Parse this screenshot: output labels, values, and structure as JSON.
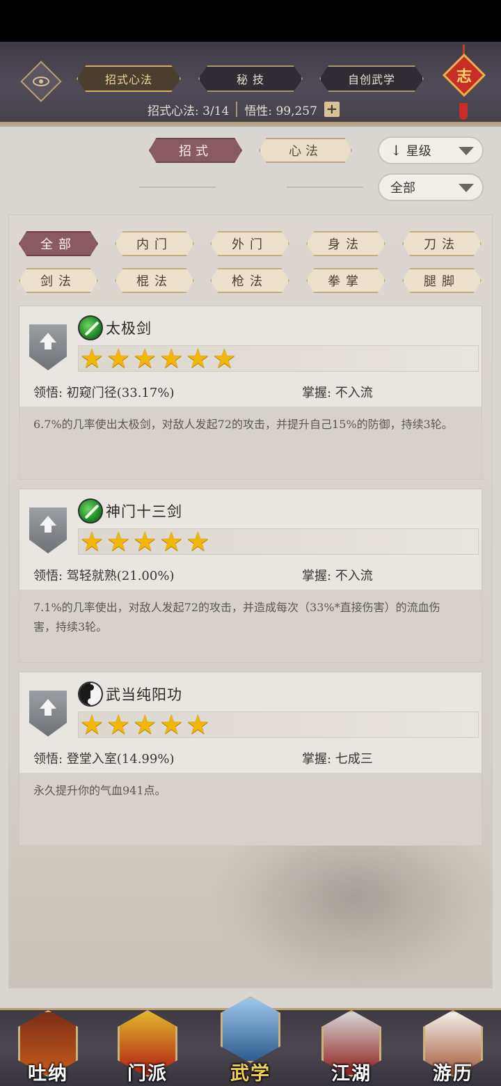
{
  "header": {
    "tabs": [
      {
        "label": "招式心法",
        "active": true
      },
      {
        "label": "秘 技",
        "active": false
      },
      {
        "label": "自创武学",
        "active": false
      }
    ],
    "stats_label": "招式心法: 3/14",
    "wuxing_label": "悟性: 99,257",
    "plus": "+",
    "knot_char": "志"
  },
  "filters": {
    "segment_zhaoshi": "招式",
    "segment_xinfa": "心法",
    "sort_arrow": "↓",
    "sort_label": "星级",
    "scope_label": "全部"
  },
  "categories": [
    "全部",
    "内门",
    "外门",
    "身法",
    "刀法",
    "剑法",
    "棍法",
    "枪法",
    "拳掌",
    "腿脚"
  ],
  "active_category": "全部",
  "skills": [
    {
      "name": "太极剑",
      "icon": "sword-skill-icon",
      "stars": 6,
      "comprehension": "领悟: 初窥门径(33.17%)",
      "mastery": "掌握: 不入流",
      "description": "6.7%的几率使出太极剑，对敌人发起72的攻击，并提升自己15%的防御，持续3轮。"
    },
    {
      "name": "神门十三剑",
      "icon": "sword-skill-icon",
      "stars": 5,
      "comprehension": "领悟: 驾轻就熟(21.00%)",
      "mastery": "掌握: 不入流",
      "description": "7.1%的几率使出，对敌人发起72的攻击，并造成每次（33%*直接伤害）的流血伤害，持续3轮。"
    },
    {
      "name": "武当纯阳功",
      "icon": "taiji-icon",
      "stars": 5,
      "comprehension": "领悟: 登堂入室(14.99%)",
      "mastery": "掌握: 七成三",
      "description": "永久提升你的气血941点。"
    }
  ],
  "bottom_nav": [
    {
      "label": "吐纳",
      "icon": "meditating-monk-icon"
    },
    {
      "label": "门派",
      "icon": "sect-banner-icon"
    },
    {
      "label": "武学",
      "icon": "martial-book-icon"
    },
    {
      "label": "江湖",
      "icon": "straw-hat-icon"
    },
    {
      "label": "游历",
      "icon": "white-horse-icon"
    }
  ],
  "active_nav": "武学",
  "colors": {
    "accent_maroon": "#8a5a62",
    "gold": "#b99f72",
    "star": "#f2b705"
  }
}
